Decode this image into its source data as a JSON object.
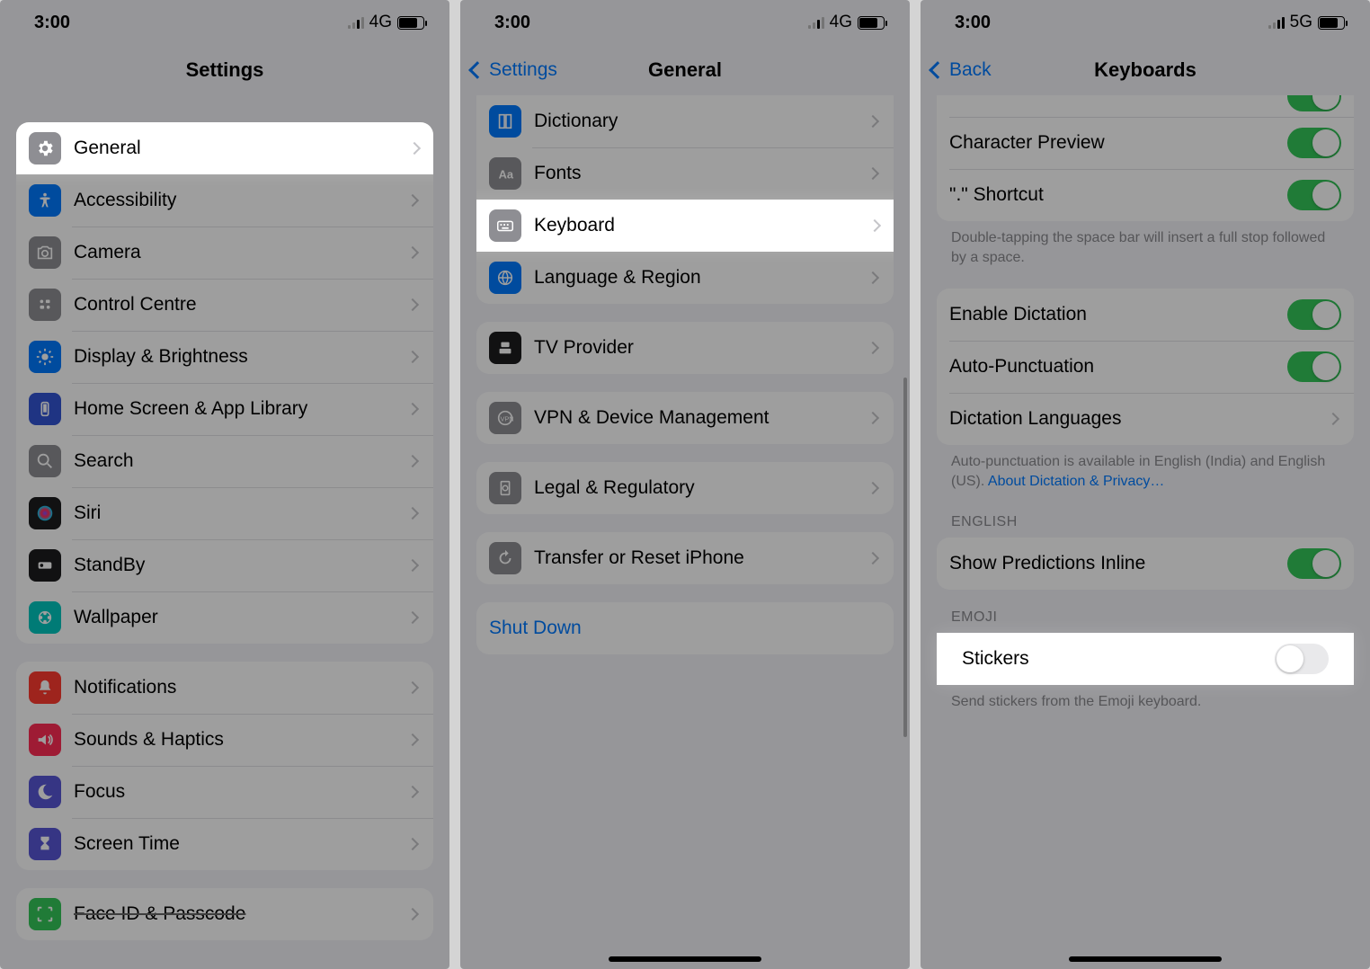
{
  "status": {
    "time": "3:00",
    "net1": "4G",
    "net2": "5G"
  },
  "phone1": {
    "title": "Settings",
    "general": "General",
    "rows": [
      {
        "label": "Accessibility",
        "icon": "accessibility",
        "color": "#007aff"
      },
      {
        "label": "Camera",
        "icon": "camera",
        "color": "#8e8e93"
      },
      {
        "label": "Control Centre",
        "icon": "control",
        "color": "#8e8e93"
      },
      {
        "label": "Display & Brightness",
        "icon": "display",
        "color": "#007aff"
      },
      {
        "label": "Home Screen & App Library",
        "icon": "home",
        "color": "#3355d4"
      },
      {
        "label": "Search",
        "icon": "search",
        "color": "#8e8e93"
      },
      {
        "label": "Siri",
        "icon": "siri",
        "color": "#1c1c1e"
      },
      {
        "label": "StandBy",
        "icon": "standby",
        "color": "#1c1c1e"
      },
      {
        "label": "Wallpaper",
        "icon": "wallpaper",
        "color": "#00c7be"
      }
    ],
    "rows2": [
      {
        "label": "Notifications",
        "icon": "bell",
        "color": "#ff3b30"
      },
      {
        "label": "Sounds & Haptics",
        "icon": "sound",
        "color": "#ff2d55"
      },
      {
        "label": "Focus",
        "icon": "moon",
        "color": "#5856d6"
      },
      {
        "label": "Screen Time",
        "icon": "hourglass",
        "color": "#5856d6"
      }
    ],
    "partial": "Face ID & Passcode"
  },
  "phone2": {
    "back": "Settings",
    "title": "General",
    "rows1": [
      {
        "label": "Dictionary",
        "icon": "book",
        "color": "#007aff"
      },
      {
        "label": "Fonts",
        "icon": "fonts",
        "color": "#8e8e93"
      }
    ],
    "keyboard": "Keyboard",
    "rows1b": [
      {
        "label": "Language & Region",
        "icon": "globe",
        "color": "#007aff"
      }
    ],
    "rows2": [
      {
        "label": "TV Provider",
        "icon": "tv",
        "color": "#1c1c1e"
      }
    ],
    "rows3": [
      {
        "label": "VPN & Device Management",
        "icon": "vpn",
        "color": "#8e8e93"
      }
    ],
    "rows4": [
      {
        "label": "Legal & Regulatory",
        "icon": "legal",
        "color": "#8e8e93"
      }
    ],
    "rows5": [
      {
        "label": "Transfer or Reset iPhone",
        "icon": "reset",
        "color": "#8e8e93"
      }
    ],
    "shutdown": "Shut Down"
  },
  "phone3": {
    "back": "Back",
    "title": "Keyboards",
    "toggles1": [
      {
        "label": "Character Preview",
        "on": true
      },
      {
        "label": "\".\" Shortcut",
        "on": true
      }
    ],
    "note1": "Double-tapping the space bar will insert a full stop followed by a space.",
    "toggles2": [
      {
        "label": "Enable Dictation",
        "on": true
      },
      {
        "label": "Auto-Punctuation",
        "on": true
      }
    ],
    "dictlang": "Dictation Languages",
    "note2a": "Auto-punctuation is available in English (India) and English (US). ",
    "note2link": "About Dictation & Privacy…",
    "header_english": "ENGLISH",
    "predictions": {
      "label": "Show Predictions Inline",
      "on": true
    },
    "header_emoji": "EMOJI",
    "stickers": {
      "label": "Stickers",
      "on": false
    },
    "note3": "Send stickers from the Emoji keyboard."
  }
}
